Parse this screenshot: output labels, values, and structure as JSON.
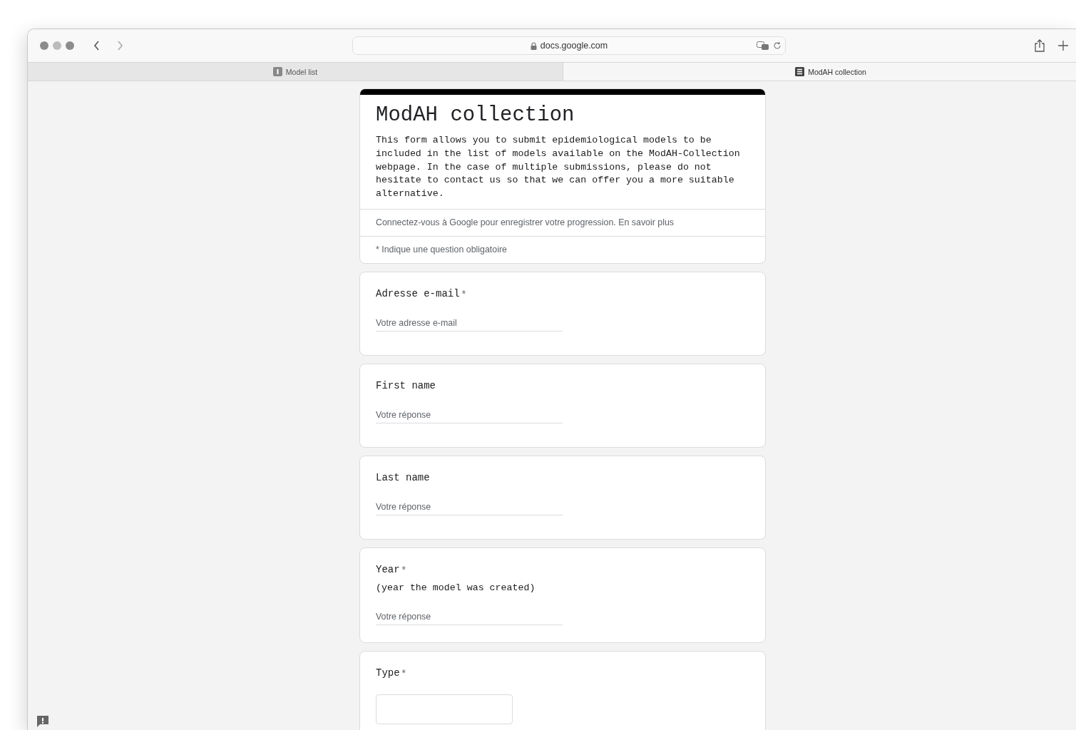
{
  "browser": {
    "address": "docs.google.com",
    "tabs": [
      {
        "label": "Model list",
        "selected": false
      },
      {
        "label": "ModAH collection",
        "selected": true
      }
    ]
  },
  "form": {
    "title": "ModAH collection",
    "description": "This form allows you to submit epidemiological models to be included in the list of models available on the ModAH-Collection webpage. In the case of multiple submissions, please do not hesitate to contact us so that we can offer you a more suitable alternative.",
    "sign_in_note": "Connectez-vous à Google pour enregistrer votre progression. En savoir plus",
    "required_note": "* Indique une question obligatoire",
    "questions": [
      {
        "kind": "text",
        "label": "Adresse e-mail",
        "required_mark": "*",
        "placeholder": "Votre adresse e-mail"
      },
      {
        "kind": "text",
        "label": "First name",
        "placeholder": "Votre réponse"
      },
      {
        "kind": "text",
        "label": "Last name",
        "placeholder": "Votre réponse"
      },
      {
        "kind": "text",
        "label": "Year",
        "required_mark": "*",
        "description": "(year the model was created)",
        "placeholder": "Votre réponse"
      },
      {
        "kind": "dropdown",
        "label": "Type",
        "required_mark": "*"
      }
    ]
  }
}
